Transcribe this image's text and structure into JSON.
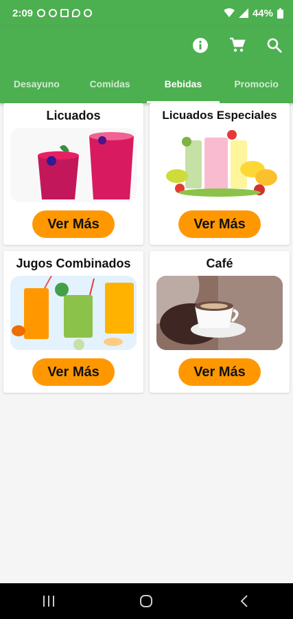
{
  "status": {
    "time": "2:09",
    "battery": "44%"
  },
  "actions": [
    {
      "icon": "info-icon"
    },
    {
      "icon": "cart-icon"
    },
    {
      "icon": "search-icon"
    }
  ],
  "tabs": [
    {
      "label": "Desayuno"
    },
    {
      "label": "Comidas"
    },
    {
      "label": "Bebidas",
      "active": true
    },
    {
      "label": "Promocio"
    }
  ],
  "cards": [
    {
      "title": "Licuados",
      "button": "Ver Más"
    },
    {
      "title": "Licuados Especiales",
      "button": "Ver Más"
    },
    {
      "title": "Jugos Combinados",
      "button": "Ver Más"
    },
    {
      "title": "Café",
      "button": "Ver Más"
    }
  ],
  "colors": {
    "primary": "#4caf50",
    "accent": "#ff9800"
  }
}
